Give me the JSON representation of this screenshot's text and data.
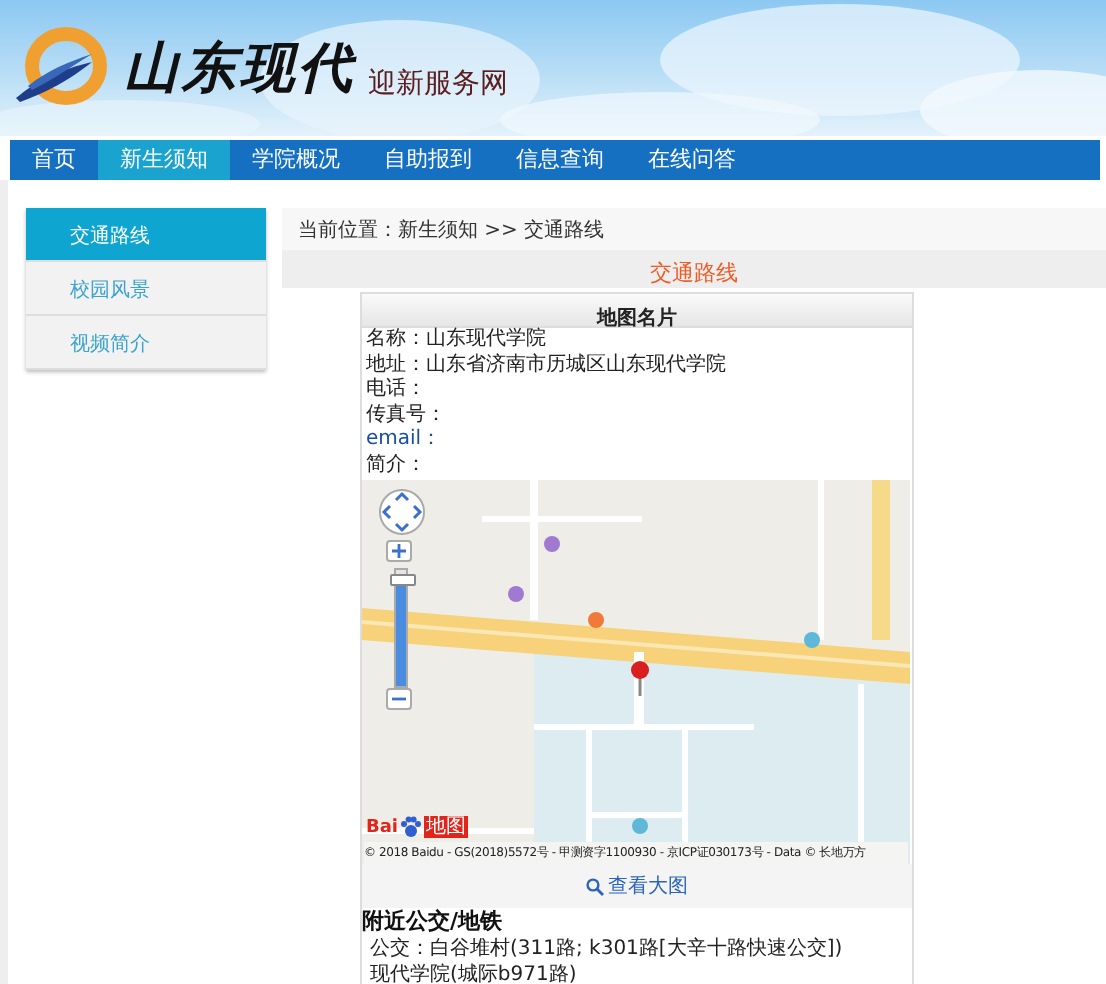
{
  "header": {
    "logo_text": "山东现代",
    "subtitle": "迎新服务网"
  },
  "nav": [
    {
      "label": "首页",
      "selected": false
    },
    {
      "label": "新生须知",
      "selected": true
    },
    {
      "label": "学院概况",
      "selected": false
    },
    {
      "label": "自助报到",
      "selected": false
    },
    {
      "label": "信息查询",
      "selected": false
    },
    {
      "label": "在线问答",
      "selected": false
    }
  ],
  "sidebar": [
    {
      "label": "交通路线",
      "selected": true
    },
    {
      "label": "校园风景",
      "selected": false
    },
    {
      "label": "视频简介",
      "selected": false
    }
  ],
  "breadcrumb": "当前位置：新生须知 >> 交通路线",
  "page_title": "交通路线",
  "card": {
    "title": "地图名片",
    "fields": [
      {
        "kind": "text",
        "label": "名称：",
        "value": "山东现代学院"
      },
      {
        "kind": "text",
        "label": "地址：",
        "value": "山东省济南市历城区山东现代学院"
      },
      {
        "kind": "text",
        "label": "电话："
      },
      {
        "kind": "text",
        "label": "传真号："
      },
      {
        "kind": "link",
        "label": "email："
      },
      {
        "kind": "text",
        "label": "简介："
      }
    ]
  },
  "map": {
    "zoom": {
      "level": 0.97
    },
    "logo": {
      "text": "Bai",
      "suffix": "地图"
    },
    "copyright": "© 2018 Baidu - GS(2018)5572号 - 甲测资字1100930 - 京ICP证030173号 - Data © 长地万方"
  },
  "view_larger": "查看大图",
  "nearby": {
    "title": "附近公交/地铁",
    "lines": [
      "公交：白谷堆村(311路; k301路[大辛十路快速公交])",
      "现代学院(城际b971路)"
    ]
  }
}
